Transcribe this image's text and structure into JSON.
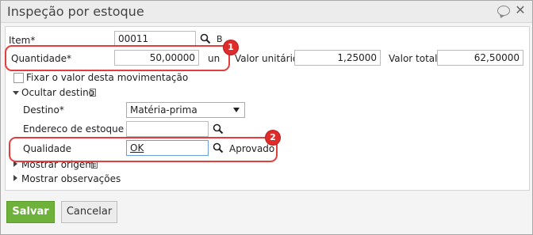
{
  "dialog": {
    "title": "Inspeção por estoque",
    "close_glyph": "✕"
  },
  "form": {
    "item": {
      "label": "Item*",
      "value": "00011",
      "suffix": "B"
    },
    "quantidade": {
      "label": "Quantidade*",
      "value": "50,00000",
      "unit": "un"
    },
    "valor_unitario": {
      "label": "Valor unitário",
      "value": "1,25000"
    },
    "valor_total": {
      "label": "Valor total",
      "value": "62,50000"
    },
    "fixar": {
      "label": "Fixar o valor desta movimentação"
    },
    "ocultar_destino": {
      "label": "Ocultar destino"
    },
    "destino": {
      "label": "Destino*",
      "value": "Matéria-prima"
    },
    "endereco": {
      "label": "Endereco de estoque",
      "value": ""
    },
    "qualidade": {
      "label": "Qualidade",
      "value": "OK",
      "status": "Aprovado"
    },
    "mostrar_origem": {
      "label": "Mostrar origem"
    },
    "mostrar_observacoes": {
      "label": "Mostrar observações"
    }
  },
  "annotations": {
    "badge1": "1",
    "badge2": "2",
    "color": "#e33d3d"
  },
  "buttons": {
    "save": "Salvar",
    "cancel": "Cancelar"
  },
  "colors": {
    "save_button": "#6fb23b",
    "highlight": "#e33d3d"
  }
}
